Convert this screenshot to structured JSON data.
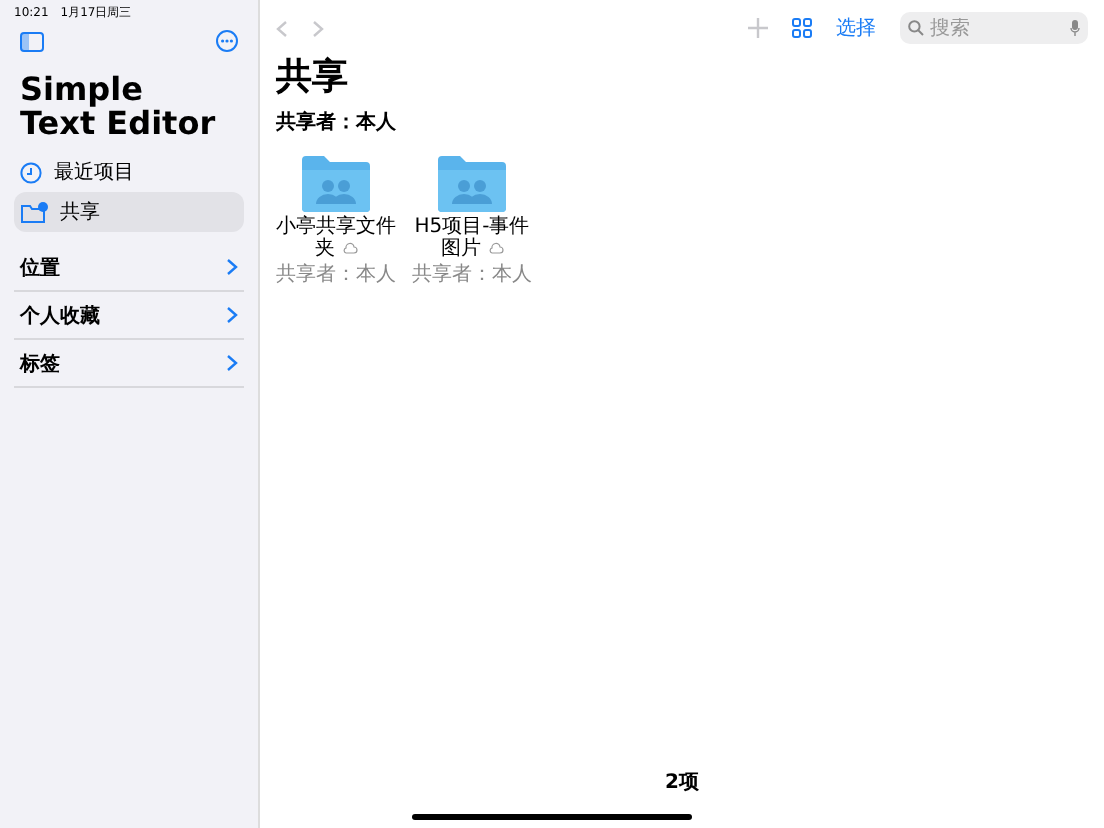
{
  "status_bar": {
    "time": "10:21",
    "date": "1月17日周三"
  },
  "sidebar": {
    "title_lines": [
      "Simple",
      "Text Editor"
    ],
    "items": [
      {
        "label": "最近项目",
        "kind": "recent",
        "selected": false
      },
      {
        "label": "共享",
        "kind": "shared",
        "selected": true
      }
    ],
    "sections": [
      {
        "label": "位置"
      },
      {
        "label": "个人收藏"
      },
      {
        "label": "标签"
      }
    ]
  },
  "toolbar": {
    "select_label": "选择",
    "search": {
      "placeholder": "搜索"
    }
  },
  "main": {
    "title": "共享",
    "group_label": "共享者：本人",
    "folders": [
      {
        "name": "小亭共享文件夹",
        "shared_by": "共享者：本人"
      },
      {
        "name": "H5项目-事件图片",
        "shared_by": "共享者：本人"
      }
    ],
    "count": "2项"
  }
}
